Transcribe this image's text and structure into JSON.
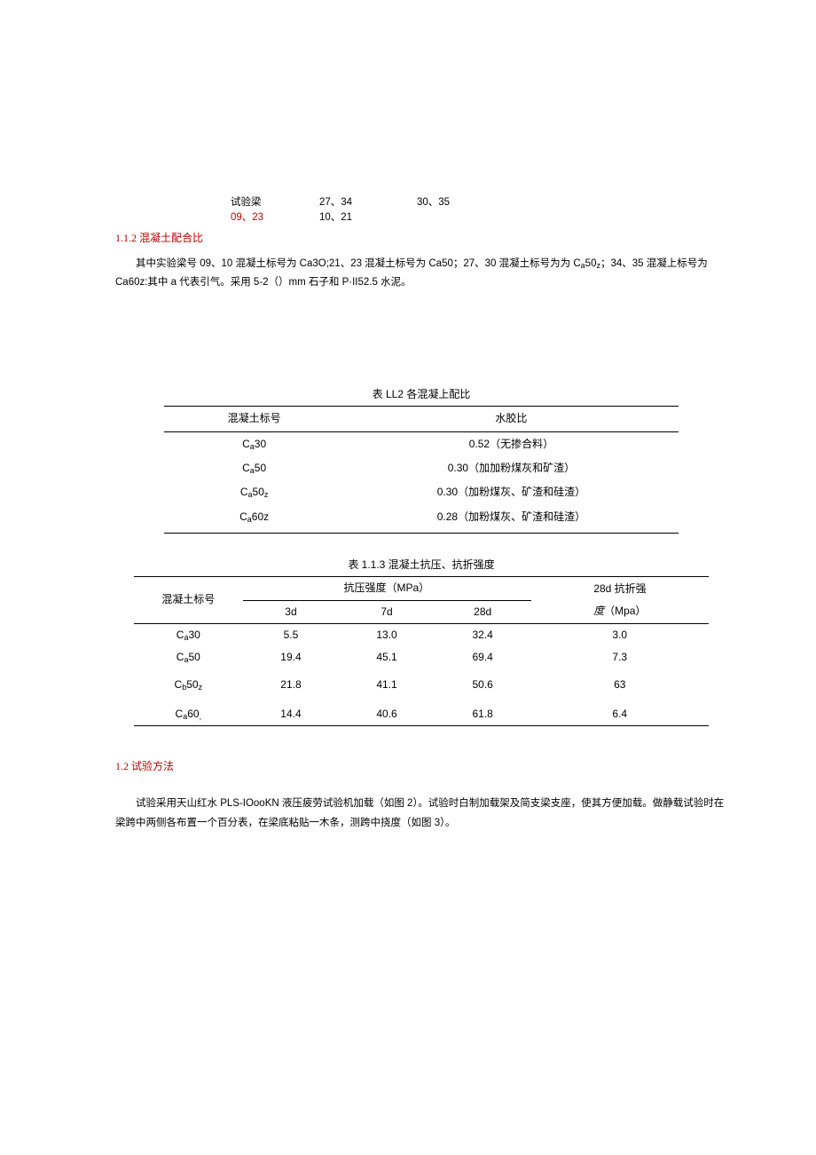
{
  "topBlock": {
    "r1c1": "试验梁",
    "r1c2": "27、34",
    "r1c3": "30、35",
    "r2c1": "09、23",
    "r2c2": "10、21"
  },
  "heading112": "1.1.2   混凝土配合比",
  "para112": {
    "t1": "其中实验梁号 09、10 混凝土标号为 Ca3O;21、23 混凝土标号为 Ca50；27、30 混凝土标号为为 C",
    "t2": "50",
    "t3": "；34、35 混凝上标号为",
    "t4": "Ca60z:其中 a 代表引气。采用 5-2（）mm 石子和 P·II52.5 水泥。"
  },
  "table1": {
    "caption": "表 LL2 各混凝上配比",
    "h1": "混凝土标号",
    "h2": "水胶比",
    "rows": [
      {
        "label_pre": "C",
        "label_sub": "a",
        "label_post": "30",
        "val": "0.52（无掺合料）"
      },
      {
        "label_pre": "C",
        "label_sub": "a",
        "label_post": "50",
        "val": "0.30（加加粉煤灰和矿渣）"
      },
      {
        "label_pre": "C",
        "label_sub": "a",
        "label_post": "50",
        "label_sub2": "z",
        "val": "0.30（加粉煤灰、矿渣和硅渣）"
      },
      {
        "label_pre": "C",
        "label_sub": "a",
        "label_post": "60z",
        "val": "0.28（加粉煤灰、矿渣和硅渣）"
      }
    ]
  },
  "table2": {
    "caption": "表 1.1.3 混凝土抗压、抗折强度",
    "h_label": "混凝土标号",
    "h_compress": "抗压强度（MPa）",
    "h_3d": "3d",
    "h_7d": "7d",
    "h_28d": "28d",
    "h_flex1": "28d 抗折强",
    "h_flex2_a": "度",
    "h_flex2_b": "（Mpa）",
    "rows": [
      {
        "label_pre": "C",
        "label_sub": "a",
        "label_post": "30",
        "d3": "5.5",
        "d7": "13.0",
        "d28": "32.4",
        "flex": "3.0"
      },
      {
        "label_pre": "C",
        "label_sub": "a",
        "label_post": "50",
        "d3": "19.4",
        "d7": "45.1",
        "d28": "69.4",
        "flex": "7.3"
      },
      {
        "label_pre": "C",
        "label_sub": "b",
        "label_post": "50",
        "label_sub2": "z",
        "d3": "21.8",
        "d7": "41.1",
        "d28": "50.6",
        "flex": "63"
      },
      {
        "label_pre": "C",
        "label_sub": "a",
        "label_post": "60",
        "label_sub2": ",",
        "d3": "14.4",
        "d7": "40.6",
        "d28": "61.8",
        "flex": "6.4"
      }
    ]
  },
  "heading12": "1.2   试验方法",
  "para12": "试验采用天山红水 PLS-IOooKN 液压疲劳试验机加载（如图 2）。试验时白制加载架及简支梁支座，使其方便加载。做静载试验时在梁跨中两侧各布置一个百分表，在梁底粘贴一木条，测跨中挠度（如图 3）。"
}
